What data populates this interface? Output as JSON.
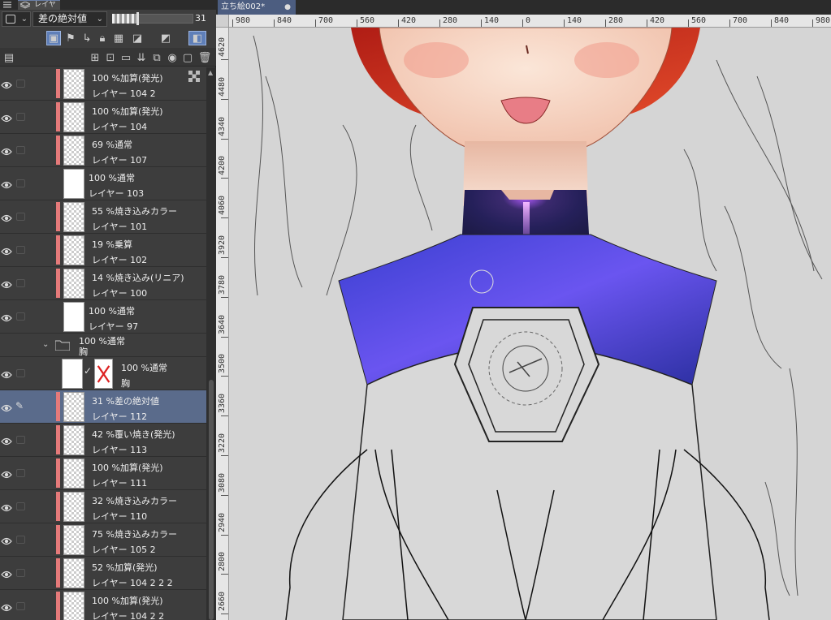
{
  "panel": {
    "tab_label": "レイヤー",
    "blend_mode": "差の絶対値",
    "opacity_value": "31",
    "opacity_fraction": 0.31
  },
  "layers": [
    {
      "line1": "100 %加算(発光)",
      "line2": "レイヤー 104 2",
      "thumb": "checker",
      "extra": "grid"
    },
    {
      "line1": "100 %加算(発光)",
      "line2": "レイヤー 104",
      "thumb": "checker"
    },
    {
      "line1": "69 %通常",
      "line2": "レイヤー 107",
      "thumb": "checker"
    },
    {
      "line1": "100 %通常",
      "line2": "レイヤー 103",
      "thumb": "white",
      "nobar": true
    },
    {
      "line1": "55 %焼き込みカラー",
      "line2": "レイヤー 101",
      "thumb": "checker"
    },
    {
      "line1": "19 %乗算",
      "line2": "レイヤー 102",
      "thumb": "checker"
    },
    {
      "line1": "14 %焼き込み(リニア)",
      "line2": "レイヤー 100",
      "thumb": "checker"
    },
    {
      "line1": "100 %通常",
      "line2": "レイヤー 97",
      "thumb": "white",
      "nobar": true
    }
  ],
  "folder": {
    "line1": "100 %通常",
    "line2": "胸"
  },
  "folder_child": {
    "line1": "100 %通常",
    "line2": "胸"
  },
  "layers_after": [
    {
      "line1": "31 %差の絶対値",
      "line2": "レイヤー 112",
      "active": true
    },
    {
      "line1": "42 %覆い焼き(発光)",
      "line2": "レイヤー 113"
    },
    {
      "line1": "100 %加算(発光)",
      "line2": "レイヤー 111"
    },
    {
      "line1": "32 %焼き込みカラー",
      "line2": "レイヤー 110"
    },
    {
      "line1": "75 %焼き込みカラー",
      "line2": "レイヤー 105 2"
    },
    {
      "line1": "52 %加算(発光)",
      "line2": "レイヤー 104 2 2 2"
    },
    {
      "line1": "100 %加算(発光)",
      "line2": "レイヤー 104 2 2"
    }
  ],
  "document": {
    "tab_title": "立ち絵002*"
  },
  "rulers": {
    "h_labels": [
      "980",
      "840",
      "700",
      "560",
      "420",
      "280",
      "140",
      "0",
      "140",
      "280",
      "420",
      "560",
      "700",
      "840",
      "980"
    ],
    "v_labels": [
      "4620",
      "4480",
      "4340",
      "4200",
      "4060",
      "3920",
      "3780",
      "3640",
      "3500",
      "3360",
      "3220",
      "3080",
      "2940",
      "2800",
      "2660"
    ]
  },
  "colors": {
    "accent": "#5f7fb8",
    "layer_bar": "#e57a7a",
    "hair": "#c0281e",
    "suit_glow": "#b25cff"
  }
}
